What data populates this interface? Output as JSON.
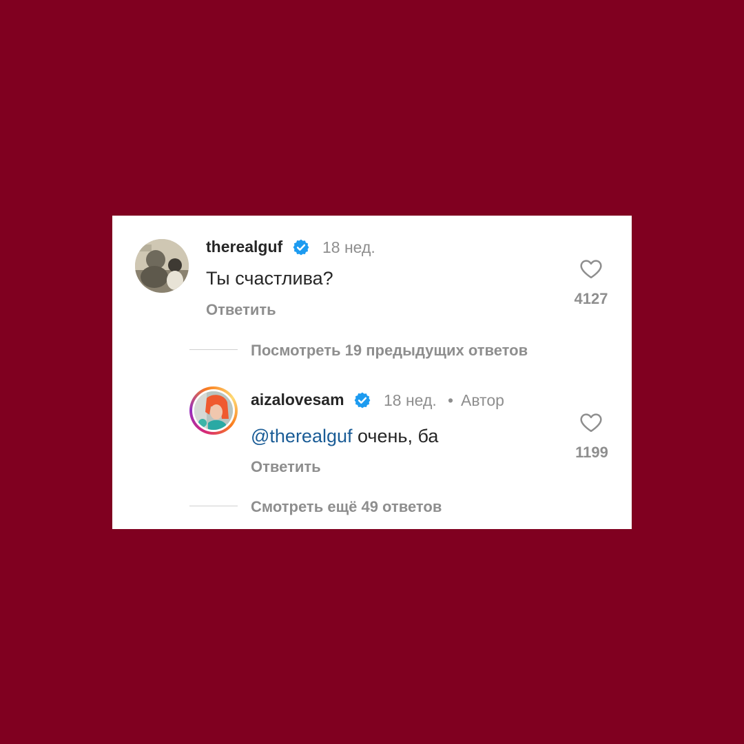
{
  "colors": {
    "background": "#800020",
    "card": "#ffffff",
    "verified": "#1d9bf0",
    "mention": "#1a5c96",
    "muted": "#8e8e8e"
  },
  "comments": [
    {
      "username": "therealguf",
      "verified": true,
      "time": "18 нед.",
      "text": "Ты счастлива?",
      "reply_label": "Ответить",
      "likes": "4127",
      "avatar_icon": "user-avatar-photo"
    },
    {
      "username": "aizalovesam",
      "verified": true,
      "time": "18 нед.",
      "author_separator": "•",
      "author_label": "Автор",
      "mention": "@therealguf",
      "text": " очень, ба",
      "reply_label": "Ответить",
      "likes": "1199",
      "avatar_icon": "user-avatar-photo-story-ring"
    }
  ],
  "view_previous_replies": "Посмотреть 19 предыдущих ответов",
  "view_more_replies": "Смотреть ещё 49 ответов",
  "icons": {
    "verified": "verified-badge-icon",
    "like": "heart-icon"
  }
}
